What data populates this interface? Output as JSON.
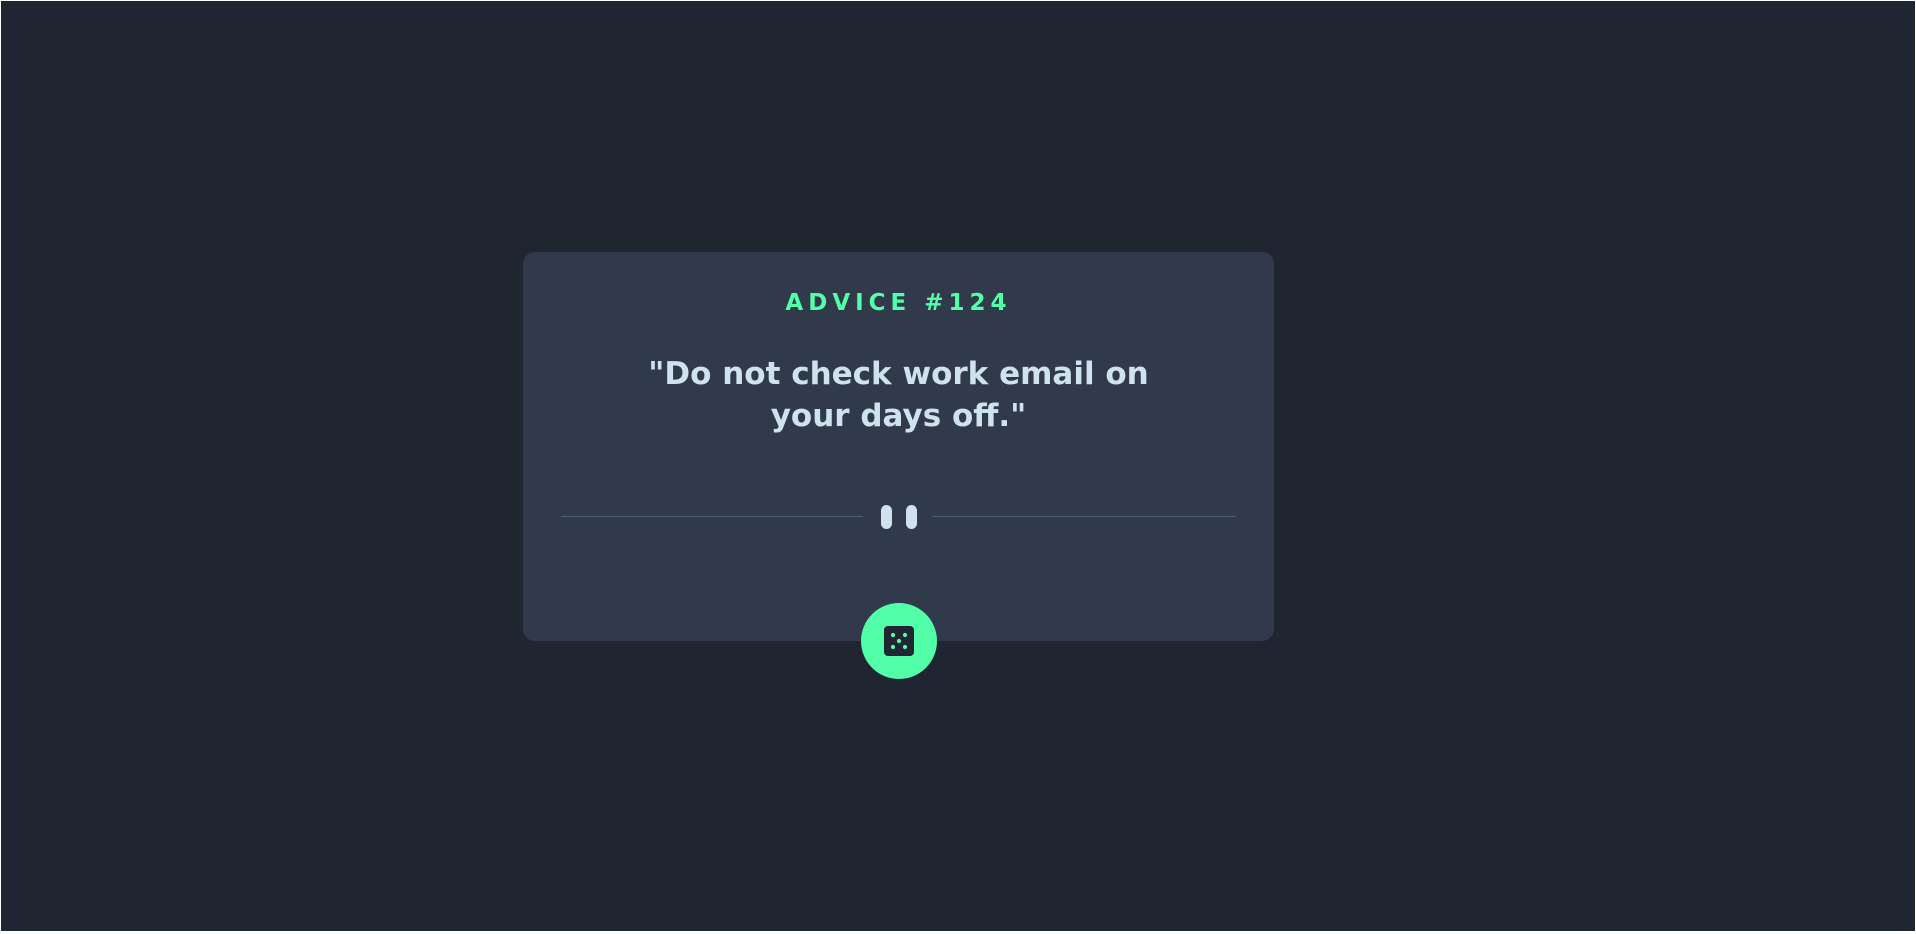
{
  "theme": {
    "background": "#1f2631",
    "card": "#313a4a",
    "accent": "#52ffa8",
    "text": "#cfe3ef"
  },
  "advice": {
    "heading": "ADVICE #124",
    "quote": "\"Do not check work email on your days off.\""
  },
  "icons": {
    "divider": "pause-icon",
    "generate": "dice-icon"
  }
}
